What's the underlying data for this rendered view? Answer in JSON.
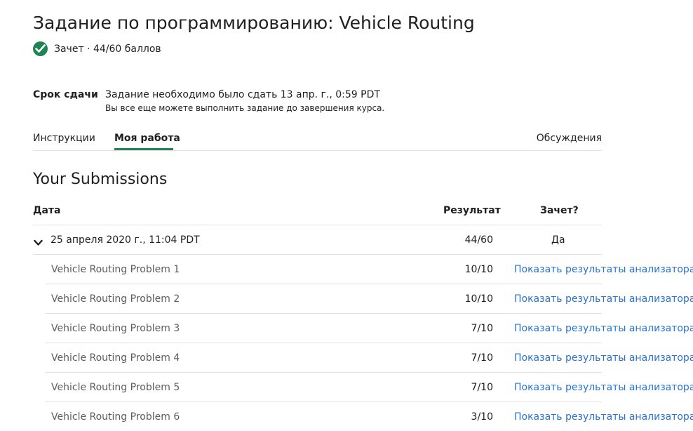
{
  "header": {
    "title": "Задание по программированию: Vehicle Routing",
    "status": "Зачет · 44/60 баллов"
  },
  "deadline": {
    "label": "Срок сдачи",
    "text": "Задание необходимо было сдать 13 апр. г., 0:59 PDT",
    "note": "Вы все еще можете выполнить задание до завершения курса."
  },
  "tabs": {
    "instructions": "Инструкции",
    "my_work": "Моя работа",
    "discussions": "Обсуждения"
  },
  "submissions": {
    "title": "Your Submissions",
    "columns": {
      "date": "Дата",
      "result": "Результат",
      "passed": "Зачет?"
    },
    "entry": {
      "date": "25 апреля 2020 г., 11:04 PDT",
      "result": "44/60",
      "passed": "Да"
    },
    "problems": [
      {
        "name": "Vehicle Routing Problem 1",
        "score": "10/10",
        "link": "Показать результаты анализатора"
      },
      {
        "name": "Vehicle Routing Problem 2",
        "score": "10/10",
        "link": "Показать результаты анализатора"
      },
      {
        "name": "Vehicle Routing Problem 3",
        "score": "7/10",
        "link": "Показать результаты анализатора"
      },
      {
        "name": "Vehicle Routing Problem 4",
        "score": "7/10",
        "link": "Показать результаты анализатора"
      },
      {
        "name": "Vehicle Routing Problem 5",
        "score": "7/10",
        "link": "Показать результаты анализатора"
      },
      {
        "name": "Vehicle Routing Problem 6",
        "score": "3/10",
        "link": "Показать результаты анализатора"
      }
    ]
  },
  "colors": {
    "accent": "#1f8354",
    "link": "#2a73cc"
  },
  "icons": {
    "status": "check-circle-icon",
    "expand": "chevron-down-icon"
  }
}
